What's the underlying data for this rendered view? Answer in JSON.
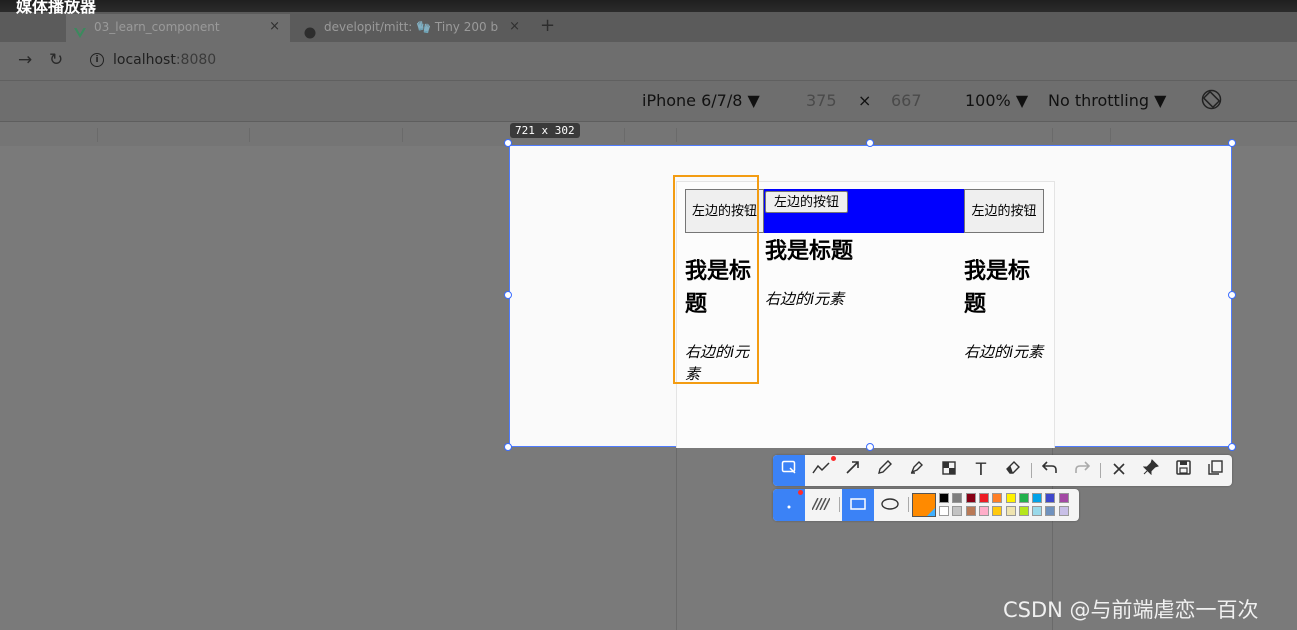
{
  "media_bar": {
    "title": "媒体播放器"
  },
  "tabs": [
    {
      "label": "03_learn_component",
      "close": "×",
      "active": true
    },
    {
      "label": "developit/mitt: 🧤 Tiny 200 b",
      "close": "×",
      "active": false
    }
  ],
  "new_tab": "+",
  "address": {
    "host": "localhost",
    "port": ":8080"
  },
  "device_toolbar": {
    "device": "iPhone 6/7/8 ▼",
    "width": "375",
    "times": "×",
    "height": "667",
    "zoom": "100% ▼",
    "throttling": "No throttling ▼"
  },
  "viewport_size": "721 x 302",
  "page": {
    "left_col": {
      "button": "左边的按钮",
      "title": "我是标题",
      "italic": "右边的i元素"
    },
    "center_col": {
      "button": "左边的按钮",
      "title": "我是标题",
      "italic": "右边的i元素"
    },
    "right_col": {
      "button": "左边的按钮",
      "title": "我是标题",
      "italic": "右边的i元素"
    },
    "accent_color": "#0000ff"
  },
  "annotation_tools": [
    "rect-select-icon",
    "polyline-icon",
    "arrow-icon",
    "pencil-icon",
    "marker-icon",
    "mosaic-icon",
    "text-icon",
    "eraser-icon",
    "undo-icon",
    "redo-icon",
    "close-icon",
    "pin-icon",
    "save-icon",
    "copy-icon"
  ],
  "palette": {
    "current": "#ff8a00",
    "top": [
      "#000000",
      "#7f7f7f",
      "#880015",
      "#ed1c24",
      "#ff7f27",
      "#fff200",
      "#22b14c",
      "#00a2e8",
      "#3f48cc",
      "#a349a4"
    ],
    "bottom": [
      "#ffffff",
      "#c3c3c3",
      "#b97a57",
      "#ffaec9",
      "#ffc90e",
      "#efe4b0",
      "#b5e61d",
      "#99d9ea",
      "#7092be",
      "#c8bfe7"
    ]
  },
  "watermark": "CSDN @与前端虐恋一百次"
}
